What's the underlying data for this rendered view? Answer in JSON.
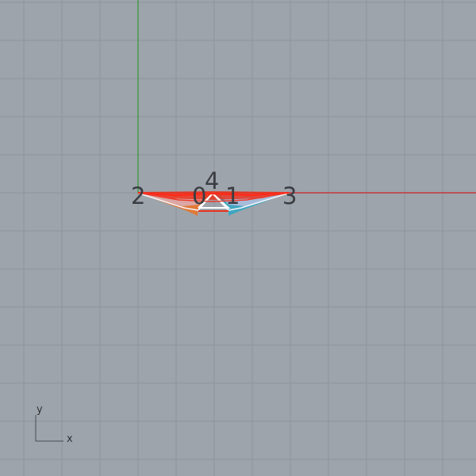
{
  "viewport": {
    "background": "#9ea4ab",
    "grid_color": "#8f959c",
    "x_axis_color": "#cc2222",
    "y_axis_color": "#2f9a2f"
  },
  "point_labels": [
    "0",
    "1",
    "2",
    "3",
    "4"
  ],
  "axis_gizmo": {
    "x_label": "x",
    "y_label": "y"
  }
}
